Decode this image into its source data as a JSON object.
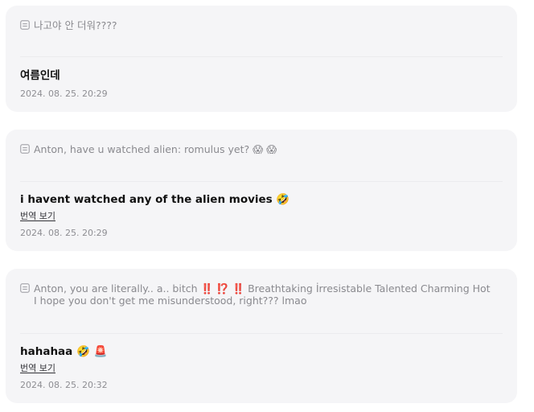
{
  "messages": [
    {
      "quote": "나고야 안 더워????",
      "reply": "여름인데",
      "translate_label": "",
      "timestamp": "2024. 08. 25. 20:29"
    },
    {
      "quote": "Anton, have u watched alien: romulus yet? 😱 😱",
      "reply": "i havent watched any of the alien movies 🤣",
      "translate_label": "번역 보기",
      "timestamp": "2024. 08. 25. 20:29"
    },
    {
      "quote": "Anton, you are literally.. a.. bitch ‼️ ⁉️ ‼️  Breathtaking İrresistable Talented Charming Hot I hope you don't get me misunderstood, right??? lmao",
      "reply": "hahahaa 🤣 🚨",
      "translate_label": "번역 보기",
      "timestamp": "2024. 08. 25. 20:32"
    }
  ],
  "icons": {
    "quote": "document-quote-icon"
  },
  "colors": {
    "card_background": "#f5f5f7",
    "quote_text": "#8a8a8f",
    "reply_text": "#111111",
    "timestamp_text": "#8e8e93"
  }
}
